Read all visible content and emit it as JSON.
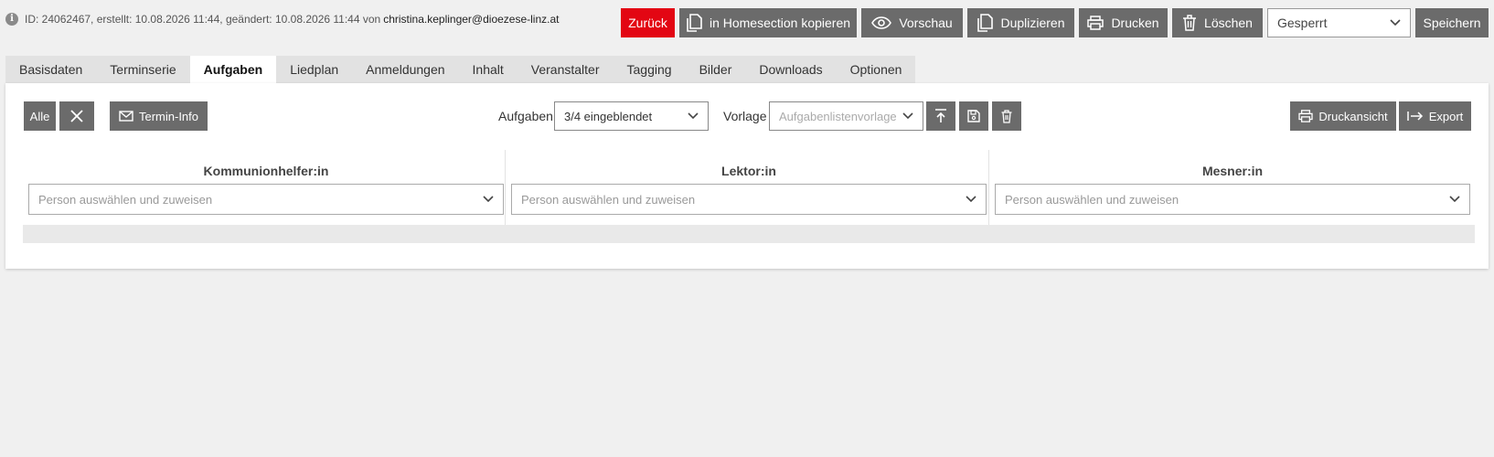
{
  "meta": {
    "info_text": "ID: 24062467, erstellt: 10.08.2026 11:44, geändert: 10.08.2026 11:44 von",
    "email": "christina.keplinger@dioezese-linz.at"
  },
  "toolbar": {
    "back": "Zurück",
    "copy_home": "in Homesection kopieren",
    "preview": "Vorschau",
    "duplicate": "Duplizieren",
    "print": "Drucken",
    "delete": "Löschen",
    "status_value": "Gesperrt",
    "save": "Speichern"
  },
  "tabs": [
    {
      "label": "Basisdaten"
    },
    {
      "label": "Terminserie"
    },
    {
      "label": "Aufgaben",
      "active": true
    },
    {
      "label": "Liedplan"
    },
    {
      "label": "Anmeldungen"
    },
    {
      "label": "Inhalt"
    },
    {
      "label": "Veranstalter"
    },
    {
      "label": "Tagging"
    },
    {
      "label": "Bilder"
    },
    {
      "label": "Downloads"
    },
    {
      "label": "Optionen"
    }
  ],
  "panel": {
    "all": "Alle",
    "termin_info": "Termin-Info",
    "tasks_label": "Aufgaben",
    "tasks_value": "3/4 eingeblendet",
    "template_label": "Vorlage",
    "template_placeholder": "Aufgabenlistenvorlage",
    "print_view": "Druckansicht",
    "export": "Export"
  },
  "columns": [
    {
      "title": "Kommunionhelfer:in",
      "placeholder": "Person auswählen und zuweisen"
    },
    {
      "title": "Lektor:in",
      "placeholder": "Person auswählen und zuweisen"
    },
    {
      "title": "Mesner:in",
      "placeholder": "Person auswählen und zuweisen"
    }
  ]
}
